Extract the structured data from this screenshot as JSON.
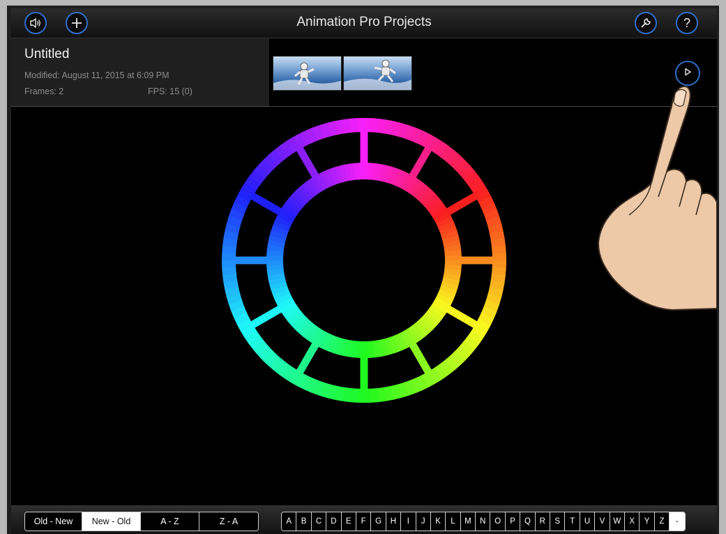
{
  "header": {
    "title": "Animation Pro Projects",
    "sound_icon": "speaker-icon",
    "add_icon": "plus-icon",
    "settings_icon": "wrench-icon",
    "help_icon": "question-mark-icon",
    "help_label": "?"
  },
  "project": {
    "title": "Untitled",
    "modified": "Modified: August 11, 2015 at 6:09 PM",
    "frames": "Frames: 2",
    "fps": "FPS: 15 (0)",
    "play_icon": "play-icon"
  },
  "sort_options": [
    {
      "label": "Old - New",
      "selected": false
    },
    {
      "label": "New - Old",
      "selected": true
    },
    {
      "label": "A - Z",
      "selected": false
    },
    {
      "label": "Z - A",
      "selected": false
    }
  ],
  "alphabet": [
    "A",
    "B",
    "C",
    "D",
    "E",
    "F",
    "G",
    "H",
    "I",
    "J",
    "K",
    "L",
    "M",
    "N",
    "O",
    "P",
    "Q",
    "R",
    "S",
    "T",
    "U",
    "V",
    "W",
    "X",
    "Y",
    "Z",
    "-"
  ],
  "colors": {
    "accent_blue": "#2f6fcc",
    "background": "#000000",
    "panel": "#1f1f1f",
    "skin": "#edc9a8"
  }
}
